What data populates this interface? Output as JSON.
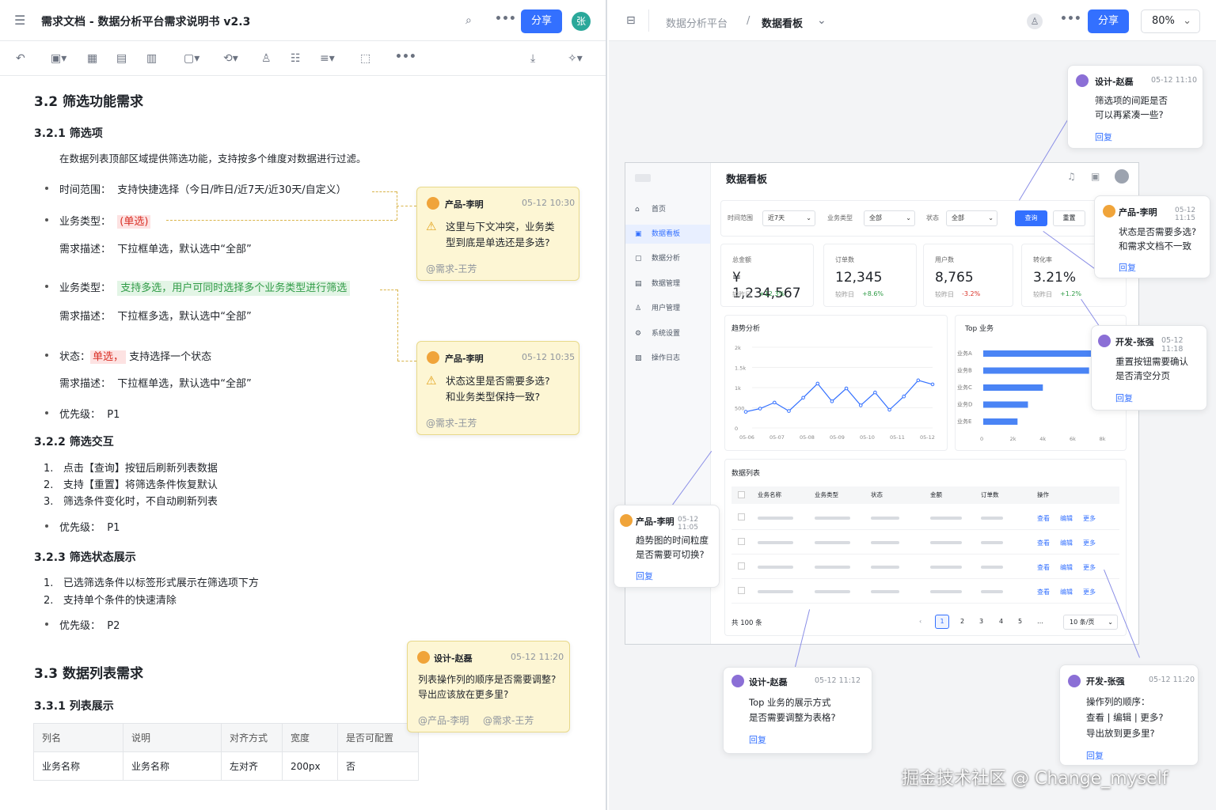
{
  "left": {
    "title": "需求文档 - 数据分析平台需求说明书 v2.3",
    "share": "分享",
    "avatar": "张",
    "s32": "3.2 筛选功能需求",
    "s321": "3.2.1 筛选项",
    "intro": "在数据列表顶部区域提供筛选功能，支持按多个维度对数据进行过滤。",
    "time_label": "时间范围：",
    "time_val": "支持快捷选择（今日/昨日/近7天/近30天/自定义）",
    "biz_label": "业务类型：",
    "biz_single": "(单选)",
    "desc_label": "需求描述：",
    "desc_val": "下拉框单选，默认选中“全部”",
    "biz2_label": "业务类型：",
    "biz2_val": "支持多选，用户可同时选择多个业务类型进行筛选",
    "desc2_val": "下拉框多选，默认选中“全部”",
    "status_label": "状态：",
    "status_single": "单选，",
    "status_val": "支持选择一个状态",
    "desc3_val": "下拉框单选，默认选中“全部”",
    "pri_label": "优先级：",
    "p1": "P1",
    "p2": "P2",
    "s322": "3.2.2 筛选交互",
    "i1": "点击【查询】按钮后刷新列表数据",
    "i2": "支持【重置】将筛选条件恢复默认",
    "i3": "筛选条件变化时，不自动刷新列表",
    "s323": "3.2.3 筛选状态展示",
    "j1": "已选筛选条件以标签形式展示在筛选项下方",
    "j2": "支持单个条件的快速清除",
    "s33": "3.3 数据列表需求",
    "s331": "3.3.1 列表展示",
    "th": [
      "列名",
      "说明",
      "对齐方式",
      "宽度",
      "是否可配置"
    ],
    "tr": [
      "业务名称",
      "业务名称",
      "左对齐",
      "200px",
      "否"
    ],
    "n1": {
      "who": "产品-李明",
      "time": "05-12 10:30",
      "text1": "这里与下文冲突，业务类",
      "text2": "型到底是单选还是多选?",
      "at": "@需求-王芳"
    },
    "n2": {
      "who": "产品-李明",
      "time": "05-12 10:35",
      "text1": "状态这里是否需要多选?",
      "text2": "和业务类型保持一致?",
      "at": "@需求-王芳"
    },
    "n3": {
      "who": "设计-赵磊",
      "time": "05-12 11:20",
      "text1": "列表操作列的顺序是否需要调整?",
      "text2": "导出应该放在更多里?",
      "at1": "@产品-李明",
      "at2": "@需求-王芳"
    }
  },
  "right": {
    "crumb1": "数据分析平台",
    "sep": "/",
    "crumb2": "数据看板",
    "share": "分享",
    "zoom": "80%",
    "board_title": "数据看板",
    "menu": [
      "首页",
      "数据看板",
      "数据分析",
      "数据管理",
      "用户管理",
      "系统设置",
      "操作日志"
    ],
    "f_time": "时间范围",
    "f_time_v": "近7天",
    "f_biz": "业务类型",
    "f_biz_v": "全部",
    "f_status": "状态",
    "f_status_v": "全部",
    "query": "查询",
    "reset": "重置",
    "kpis": [
      {
        "label": "总金额",
        "value": "¥ 1,234,567",
        "cmp": "较昨日",
        "delta": "+12.3%"
      },
      {
        "label": "订单数",
        "value": "12,345",
        "cmp": "较昨日",
        "delta": "+8.6%"
      },
      {
        "label": "用户数",
        "value": "8,765",
        "cmp": "较昨日",
        "delta": "-3.2%"
      },
      {
        "label": "转化率",
        "value": "3.21%",
        "cmp": "较昨日",
        "delta": "+1.2%"
      }
    ],
    "trend_title": "趋势分析",
    "top_title": "Top 业务",
    "list_title": "数据列表",
    "cols": [
      "业务名称",
      "业务类型",
      "状态",
      "金额",
      "订单数",
      "操作"
    ],
    "ops": [
      "查看",
      "编辑",
      "更多"
    ],
    "total": "共 100 条",
    "pages": [
      "1",
      "2",
      "3",
      "4",
      "5",
      "…"
    ],
    "per": "10 条/页",
    "c1": {
      "who": "设计-赵磊",
      "time": "05-12 11:10",
      "t1": "筛选项的间距是否",
      "t2": "可以再紧凑一些?",
      "reply": "回复"
    },
    "c2": {
      "who": "产品-李明",
      "time": "05-12 11:15",
      "t1": "状态是否需要多选?",
      "t2": "和需求文档不一致",
      "reply": "回复"
    },
    "c3": {
      "who": "开发-张强",
      "time": "05-12 11:18",
      "t1": "重置按钮需要确认",
      "t2": "是否清空分页",
      "reply": "回复"
    },
    "c4": {
      "who": "产品-李明",
      "time": "05-12 11:05",
      "t1": "趋势图的时间粒度",
      "t2": "是否需要可切换?",
      "reply": "回复"
    },
    "c5": {
      "who": "设计-赵磊",
      "time": "05-12 11:12",
      "t1": "Top 业务的展示方式",
      "t2": "是否需要调整为表格?",
      "reply": "回复"
    },
    "c6": {
      "who": "开发-张强",
      "time": "05-12 11:20",
      "t1": "操作列的顺序：",
      "t2": "查看 | 编辑 | 更多?",
      "t3": "导出放到更多里?",
      "reply": "回复"
    },
    "watermark": "掘金技术社区 @ Change_myself"
  },
  "chart_data": [
    {
      "type": "line",
      "title": "趋势分析",
      "x": [
        "05-06",
        "05-07",
        "05-08",
        "05-09",
        "05-10",
        "05-11",
        "05-12"
      ],
      "y_ticks": [
        "0",
        "500",
        "1k",
        "1.5k",
        "2k"
      ],
      "ylim": [
        0,
        2000
      ],
      "values": [
        400,
        480,
        630,
        420,
        750,
        1100,
        660,
        980,
        560,
        880,
        450,
        780,
        1180,
        1080
      ]
    },
    {
      "type": "bar",
      "title": "Top 业务",
      "categories": [
        "业务A",
        "业务B",
        "业务C",
        "业务D",
        "业务E"
      ],
      "values": [
        8000,
        7100,
        4000,
        3000,
        2300
      ],
      "x_ticks": [
        "0",
        "2k",
        "4k",
        "6k",
        "8k"
      ],
      "xlim": [
        0,
        8500
      ]
    }
  ]
}
